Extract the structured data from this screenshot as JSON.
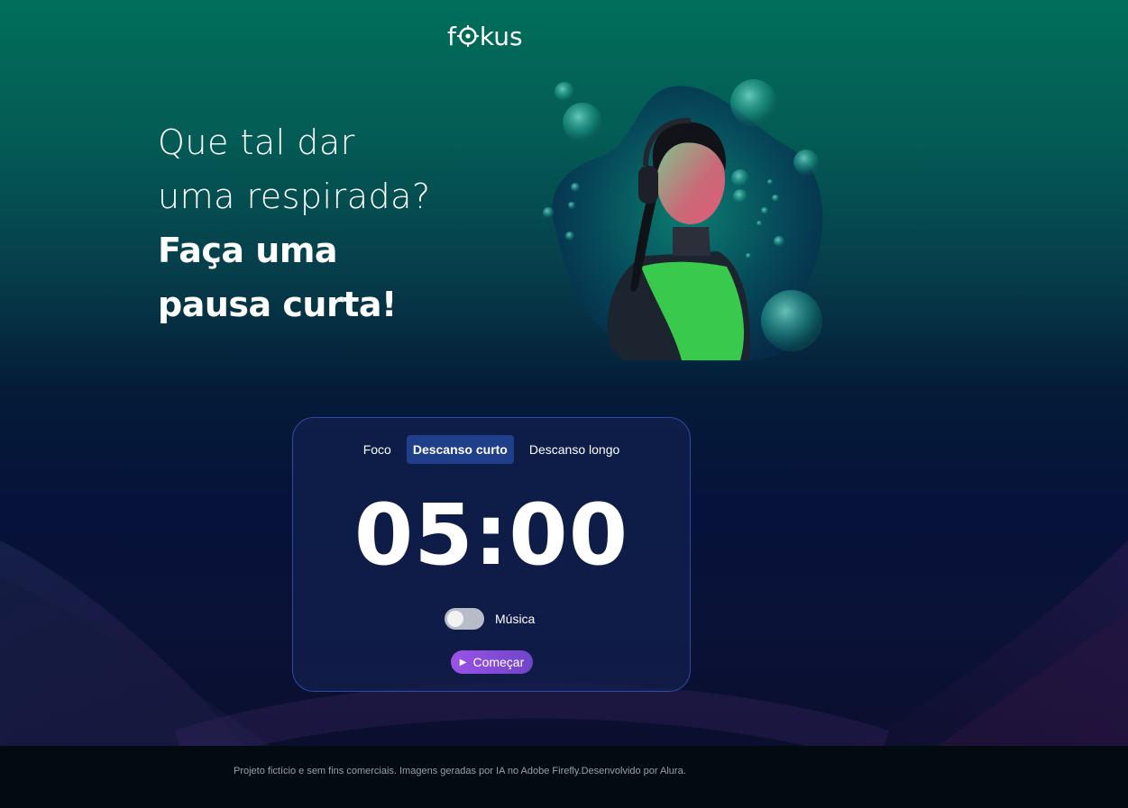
{
  "app": {
    "logo_text_start": "f",
    "logo_text_end": "kus",
    "logo_icon": "target-o-icon"
  },
  "headline": {
    "line1": "Que tal dar",
    "line2": "uma respirada?",
    "line3": "Faça uma",
    "line4": "pausa curta!"
  },
  "hero_image": {
    "description_icon": "woman-headphones-underwater-image"
  },
  "timer_card": {
    "tabs": [
      {
        "label": "Foco",
        "active": false
      },
      {
        "label": "Descanso curto",
        "active": true
      },
      {
        "label": "Descanso longo",
        "active": false
      }
    ],
    "time": "05:00",
    "music_label": "Música",
    "music_enabled": false,
    "start_label": "Começar",
    "start_icon": "play-icon"
  },
  "footer": {
    "text": "Projeto fictício e sem fins comerciais. Imagens geradas por IA no Adobe Firefly.Desenvolvido por Alura."
  },
  "colors": {
    "bg_top": "#006f5a",
    "bg_bottom": "#0b0f2e",
    "card_border": "#2f4aa8",
    "active_tab": "#1f3f8a",
    "button_gradient_start": "#9b53e6",
    "button_gradient_end": "#6f45c8"
  }
}
